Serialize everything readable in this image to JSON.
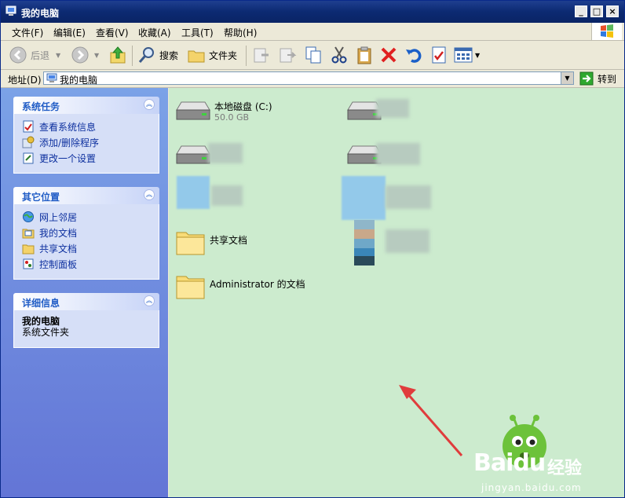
{
  "window": {
    "title": "我的电脑"
  },
  "menu": [
    "文件(F)",
    "编辑(E)",
    "查看(V)",
    "收藏(A)",
    "工具(T)",
    "帮助(H)"
  ],
  "toolbar": {
    "back_label": "后退",
    "search_label": "搜索",
    "folders_label": "文件夹"
  },
  "address": {
    "label": "地址(D)",
    "value": "我的电脑",
    "go_label": "转到"
  },
  "panels": {
    "system_tasks": {
      "title": "系统任务",
      "items": [
        "查看系统信息",
        "添加/删除程序",
        "更改一个设置"
      ]
    },
    "other_places": {
      "title": "其它位置",
      "items": [
        "网上邻居",
        "我的文档",
        "共享文档",
        "控制面板"
      ]
    },
    "details": {
      "title": "详细信息",
      "name": "我的电脑",
      "type": "系统文件夹"
    }
  },
  "content": {
    "local_disk_name": "本地磁盘 (C:)",
    "local_disk_size": "50.0 GB",
    "shared_docs": "共享文档",
    "admin_docs": "Administrator 的文档"
  },
  "watermark": {
    "brand": "Baidu",
    "brand_cn": "经验",
    "url": "jingyan.baidu.com"
  },
  "colors": {
    "titlebar": "#0c2a72",
    "content_bg": "#ccebce",
    "task_pane": "#7ba2e7",
    "annotation_arrow": "#e03c3c"
  }
}
